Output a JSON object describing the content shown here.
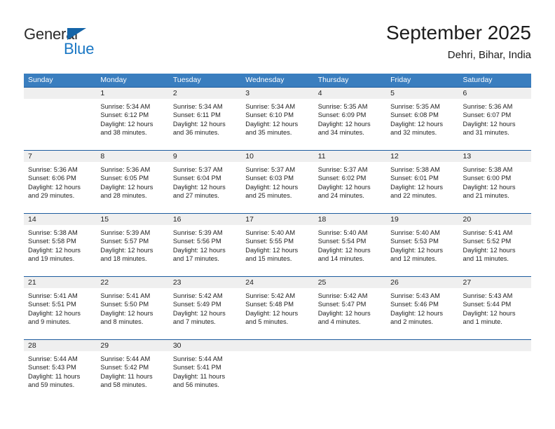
{
  "brand": {
    "name_part1": "General",
    "name_part2": "Blue",
    "color_dark": "#2b2b2b",
    "color_blue": "#1a77c4",
    "triangle_color": "#1565a8"
  },
  "header": {
    "title": "September 2025",
    "subtitle": "Dehri, Bihar, India"
  },
  "theme": {
    "header_row_bg": "#3a7ebf",
    "header_row_text": "#ffffff",
    "week_divider": "#1d5c9e",
    "daynum_strip_bg": "#efefef",
    "cell_bg": "#ffffff",
    "text": "#222222"
  },
  "weekdays": [
    {
      "label": "Sunday"
    },
    {
      "label": "Monday"
    },
    {
      "label": "Tuesday"
    },
    {
      "label": "Wednesday"
    },
    {
      "label": "Thursday"
    },
    {
      "label": "Friday"
    },
    {
      "label": "Saturday"
    }
  ],
  "weeks": [
    {
      "days": [
        {
          "date": "",
          "empty": true,
          "sunrise": "",
          "sunset": "",
          "daylight_line1": "",
          "daylight_line2": ""
        },
        {
          "date": "1",
          "empty": false,
          "sunrise": "Sunrise: 5:34 AM",
          "sunset": "Sunset: 6:12 PM",
          "daylight_line1": "Daylight: 12 hours",
          "daylight_line2": "and 38 minutes."
        },
        {
          "date": "2",
          "empty": false,
          "sunrise": "Sunrise: 5:34 AM",
          "sunset": "Sunset: 6:11 PM",
          "daylight_line1": "Daylight: 12 hours",
          "daylight_line2": "and 36 minutes."
        },
        {
          "date": "3",
          "empty": false,
          "sunrise": "Sunrise: 5:34 AM",
          "sunset": "Sunset: 6:10 PM",
          "daylight_line1": "Daylight: 12 hours",
          "daylight_line2": "and 35 minutes."
        },
        {
          "date": "4",
          "empty": false,
          "sunrise": "Sunrise: 5:35 AM",
          "sunset": "Sunset: 6:09 PM",
          "daylight_line1": "Daylight: 12 hours",
          "daylight_line2": "and 34 minutes."
        },
        {
          "date": "5",
          "empty": false,
          "sunrise": "Sunrise: 5:35 AM",
          "sunset": "Sunset: 6:08 PM",
          "daylight_line1": "Daylight: 12 hours",
          "daylight_line2": "and 32 minutes."
        },
        {
          "date": "6",
          "empty": false,
          "sunrise": "Sunrise: 5:36 AM",
          "sunset": "Sunset: 6:07 PM",
          "daylight_line1": "Daylight: 12 hours",
          "daylight_line2": "and 31 minutes."
        }
      ]
    },
    {
      "days": [
        {
          "date": "7",
          "empty": false,
          "sunrise": "Sunrise: 5:36 AM",
          "sunset": "Sunset: 6:06 PM",
          "daylight_line1": "Daylight: 12 hours",
          "daylight_line2": "and 29 minutes."
        },
        {
          "date": "8",
          "empty": false,
          "sunrise": "Sunrise: 5:36 AM",
          "sunset": "Sunset: 6:05 PM",
          "daylight_line1": "Daylight: 12 hours",
          "daylight_line2": "and 28 minutes."
        },
        {
          "date": "9",
          "empty": false,
          "sunrise": "Sunrise: 5:37 AM",
          "sunset": "Sunset: 6:04 PM",
          "daylight_line1": "Daylight: 12 hours",
          "daylight_line2": "and 27 minutes."
        },
        {
          "date": "10",
          "empty": false,
          "sunrise": "Sunrise: 5:37 AM",
          "sunset": "Sunset: 6:03 PM",
          "daylight_line1": "Daylight: 12 hours",
          "daylight_line2": "and 25 minutes."
        },
        {
          "date": "11",
          "empty": false,
          "sunrise": "Sunrise: 5:37 AM",
          "sunset": "Sunset: 6:02 PM",
          "daylight_line1": "Daylight: 12 hours",
          "daylight_line2": "and 24 minutes."
        },
        {
          "date": "12",
          "empty": false,
          "sunrise": "Sunrise: 5:38 AM",
          "sunset": "Sunset: 6:01 PM",
          "daylight_line1": "Daylight: 12 hours",
          "daylight_line2": "and 22 minutes."
        },
        {
          "date": "13",
          "empty": false,
          "sunrise": "Sunrise: 5:38 AM",
          "sunset": "Sunset: 6:00 PM",
          "daylight_line1": "Daylight: 12 hours",
          "daylight_line2": "and 21 minutes."
        }
      ]
    },
    {
      "days": [
        {
          "date": "14",
          "empty": false,
          "sunrise": "Sunrise: 5:38 AM",
          "sunset": "Sunset: 5:58 PM",
          "daylight_line1": "Daylight: 12 hours",
          "daylight_line2": "and 19 minutes."
        },
        {
          "date": "15",
          "empty": false,
          "sunrise": "Sunrise: 5:39 AM",
          "sunset": "Sunset: 5:57 PM",
          "daylight_line1": "Daylight: 12 hours",
          "daylight_line2": "and 18 minutes."
        },
        {
          "date": "16",
          "empty": false,
          "sunrise": "Sunrise: 5:39 AM",
          "sunset": "Sunset: 5:56 PM",
          "daylight_line1": "Daylight: 12 hours",
          "daylight_line2": "and 17 minutes."
        },
        {
          "date": "17",
          "empty": false,
          "sunrise": "Sunrise: 5:40 AM",
          "sunset": "Sunset: 5:55 PM",
          "daylight_line1": "Daylight: 12 hours",
          "daylight_line2": "and 15 minutes."
        },
        {
          "date": "18",
          "empty": false,
          "sunrise": "Sunrise: 5:40 AM",
          "sunset": "Sunset: 5:54 PM",
          "daylight_line1": "Daylight: 12 hours",
          "daylight_line2": "and 14 minutes."
        },
        {
          "date": "19",
          "empty": false,
          "sunrise": "Sunrise: 5:40 AM",
          "sunset": "Sunset: 5:53 PM",
          "daylight_line1": "Daylight: 12 hours",
          "daylight_line2": "and 12 minutes."
        },
        {
          "date": "20",
          "empty": false,
          "sunrise": "Sunrise: 5:41 AM",
          "sunset": "Sunset: 5:52 PM",
          "daylight_line1": "Daylight: 12 hours",
          "daylight_line2": "and 11 minutes."
        }
      ]
    },
    {
      "days": [
        {
          "date": "21",
          "empty": false,
          "sunrise": "Sunrise: 5:41 AM",
          "sunset": "Sunset: 5:51 PM",
          "daylight_line1": "Daylight: 12 hours",
          "daylight_line2": "and 9 minutes."
        },
        {
          "date": "22",
          "empty": false,
          "sunrise": "Sunrise: 5:41 AM",
          "sunset": "Sunset: 5:50 PM",
          "daylight_line1": "Daylight: 12 hours",
          "daylight_line2": "and 8 minutes."
        },
        {
          "date": "23",
          "empty": false,
          "sunrise": "Sunrise: 5:42 AM",
          "sunset": "Sunset: 5:49 PM",
          "daylight_line1": "Daylight: 12 hours",
          "daylight_line2": "and 7 minutes."
        },
        {
          "date": "24",
          "empty": false,
          "sunrise": "Sunrise: 5:42 AM",
          "sunset": "Sunset: 5:48 PM",
          "daylight_line1": "Daylight: 12 hours",
          "daylight_line2": "and 5 minutes."
        },
        {
          "date": "25",
          "empty": false,
          "sunrise": "Sunrise: 5:42 AM",
          "sunset": "Sunset: 5:47 PM",
          "daylight_line1": "Daylight: 12 hours",
          "daylight_line2": "and 4 minutes."
        },
        {
          "date": "26",
          "empty": false,
          "sunrise": "Sunrise: 5:43 AM",
          "sunset": "Sunset: 5:46 PM",
          "daylight_line1": "Daylight: 12 hours",
          "daylight_line2": "and 2 minutes."
        },
        {
          "date": "27",
          "empty": false,
          "sunrise": "Sunrise: 5:43 AM",
          "sunset": "Sunset: 5:44 PM",
          "daylight_line1": "Daylight: 12 hours",
          "daylight_line2": "and 1 minute."
        }
      ]
    },
    {
      "days": [
        {
          "date": "28",
          "empty": false,
          "sunrise": "Sunrise: 5:44 AM",
          "sunset": "Sunset: 5:43 PM",
          "daylight_line1": "Daylight: 11 hours",
          "daylight_line2": "and 59 minutes."
        },
        {
          "date": "29",
          "empty": false,
          "sunrise": "Sunrise: 5:44 AM",
          "sunset": "Sunset: 5:42 PM",
          "daylight_line1": "Daylight: 11 hours",
          "daylight_line2": "and 58 minutes."
        },
        {
          "date": "30",
          "empty": false,
          "sunrise": "Sunrise: 5:44 AM",
          "sunset": "Sunset: 5:41 PM",
          "daylight_line1": "Daylight: 11 hours",
          "daylight_line2": "and 56 minutes."
        },
        {
          "date": "",
          "empty": true,
          "sunrise": "",
          "sunset": "",
          "daylight_line1": "",
          "daylight_line2": ""
        },
        {
          "date": "",
          "empty": true,
          "sunrise": "",
          "sunset": "",
          "daylight_line1": "",
          "daylight_line2": ""
        },
        {
          "date": "",
          "empty": true,
          "sunrise": "",
          "sunset": "",
          "daylight_line1": "",
          "daylight_line2": ""
        },
        {
          "date": "",
          "empty": true,
          "sunrise": "",
          "sunset": "",
          "daylight_line1": "",
          "daylight_line2": ""
        }
      ]
    }
  ]
}
